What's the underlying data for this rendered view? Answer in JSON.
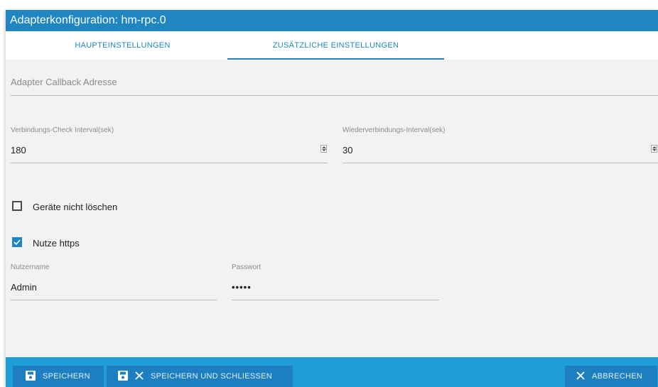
{
  "dialog": {
    "title": "Adapterkonfiguration: hm-rpc.0"
  },
  "tabs": [
    {
      "label": "HAUPTEINSTELLUNGEN",
      "active": false
    },
    {
      "label": "ZUSÄTZLICHE EINSTELLUNGEN",
      "active": true
    }
  ],
  "callback": {
    "placeholder": "Adapter Callback Adresse"
  },
  "check_interval": {
    "label": "Verbindungs-Check Interval(sek)",
    "value": "180"
  },
  "reconnect_interval": {
    "label": "Wiederverbindungs-Interval(sek)",
    "value": "30"
  },
  "dont_delete": {
    "label": "Geräte nicht löschen",
    "checked": false
  },
  "use_https": {
    "label": "Nutze https",
    "checked": true
  },
  "username": {
    "label": "Nutzername",
    "value": "Admin"
  },
  "password": {
    "label": "Passwort",
    "value": "•••••"
  },
  "buttons": {
    "save": "SPEICHERN",
    "save_close": "SPEICHERN UND SCHLIESSEN",
    "cancel": "ABBRECHEN"
  },
  "colors": {
    "accent": "#1f86c2",
    "bottom_bar": "#1f9dd4",
    "button": "#1d7fc0"
  }
}
